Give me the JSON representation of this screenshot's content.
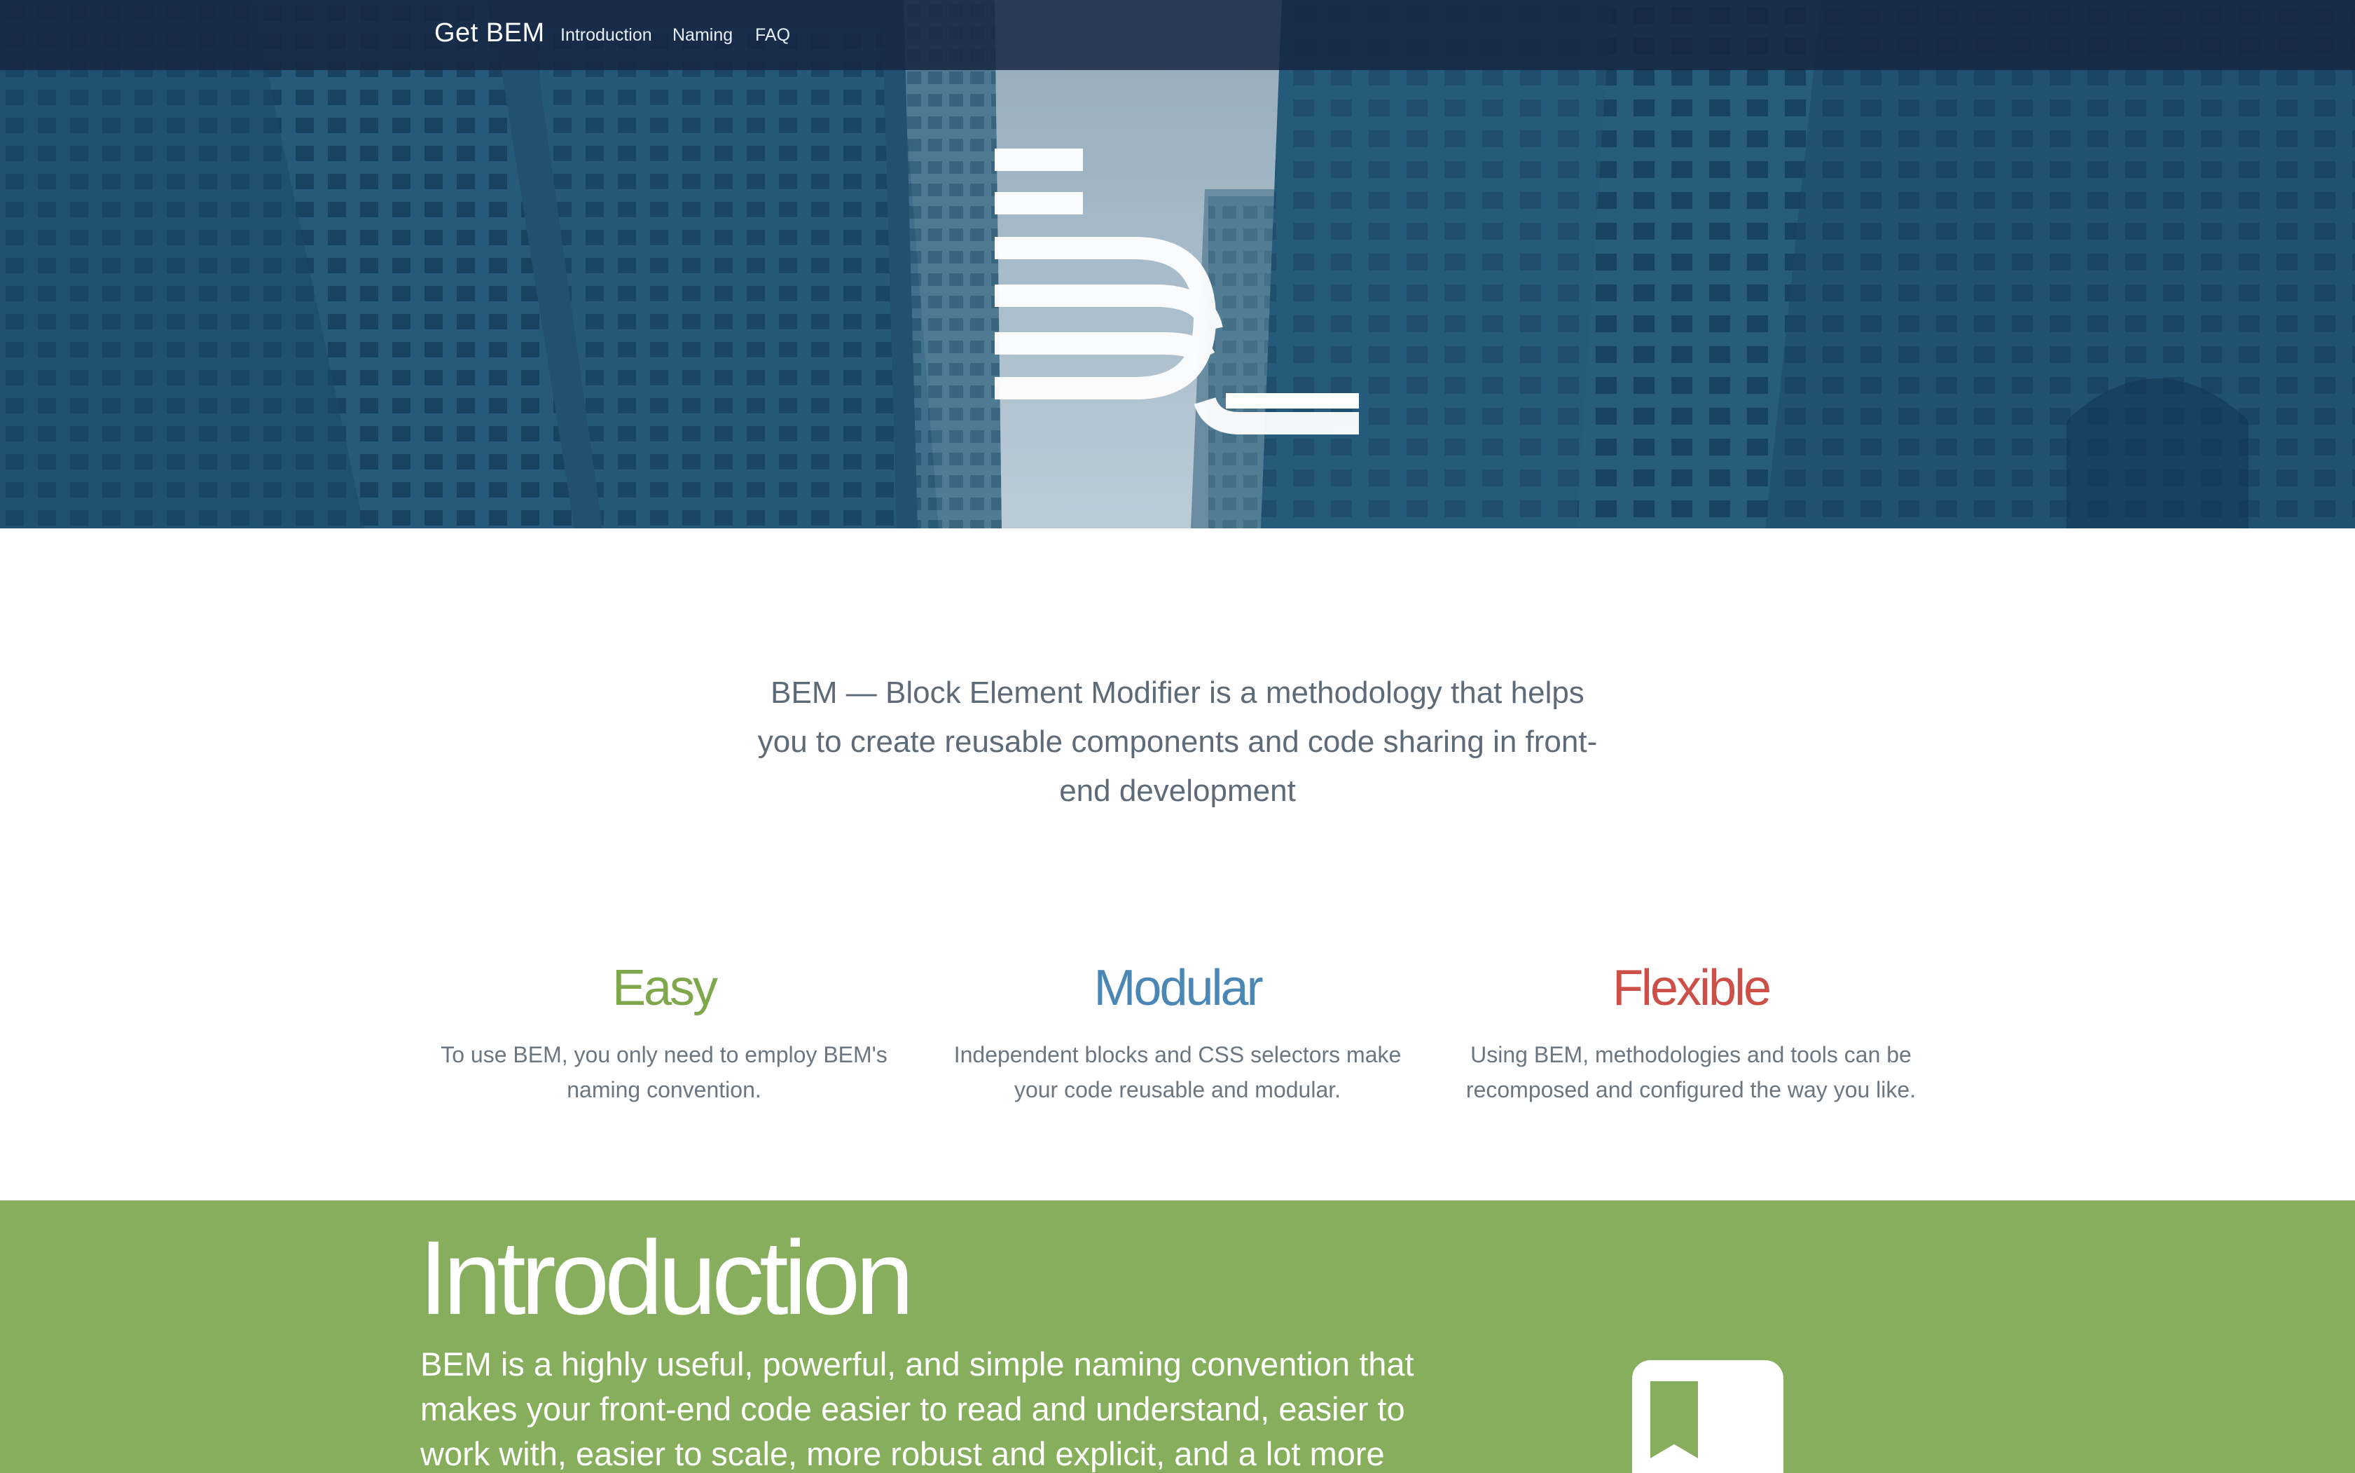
{
  "nav": {
    "brand": "Get BEM",
    "links": [
      "Introduction",
      "Naming",
      "FAQ"
    ]
  },
  "hero": {
    "logo_icon": "bem-logo-icon"
  },
  "tagline": "BEM — Block Element Modifier is a methodology that helps you to create reusable components and code sharing in front-end development",
  "features": [
    {
      "title": "Easy",
      "text": "To use BEM, you only need to employ BEM's naming convention.",
      "color": "#7fa84d"
    },
    {
      "title": "Modular",
      "text": "Independent blocks and CSS selectors make your code reusable and modular.",
      "color": "#4a87b5"
    },
    {
      "title": "Flexible",
      "text": "Using BEM, methodologies and tools can be recomposed and configured the way you like.",
      "color": "#cc4f48"
    }
  ],
  "intro": {
    "title": "Introduction",
    "text": "BEM is a highly useful, powerful, and simple naming convention that makes your front-end code easier to read and understand, easier to work with, easier to scale, more robust and explicit, and a lot more strict.",
    "icon": "bookmark-icon",
    "background": "#86ae5c"
  },
  "colors": {
    "nav_bg": "#162642",
    "hero_tint": "#2c6584",
    "text_muted": "#5d6b78"
  }
}
